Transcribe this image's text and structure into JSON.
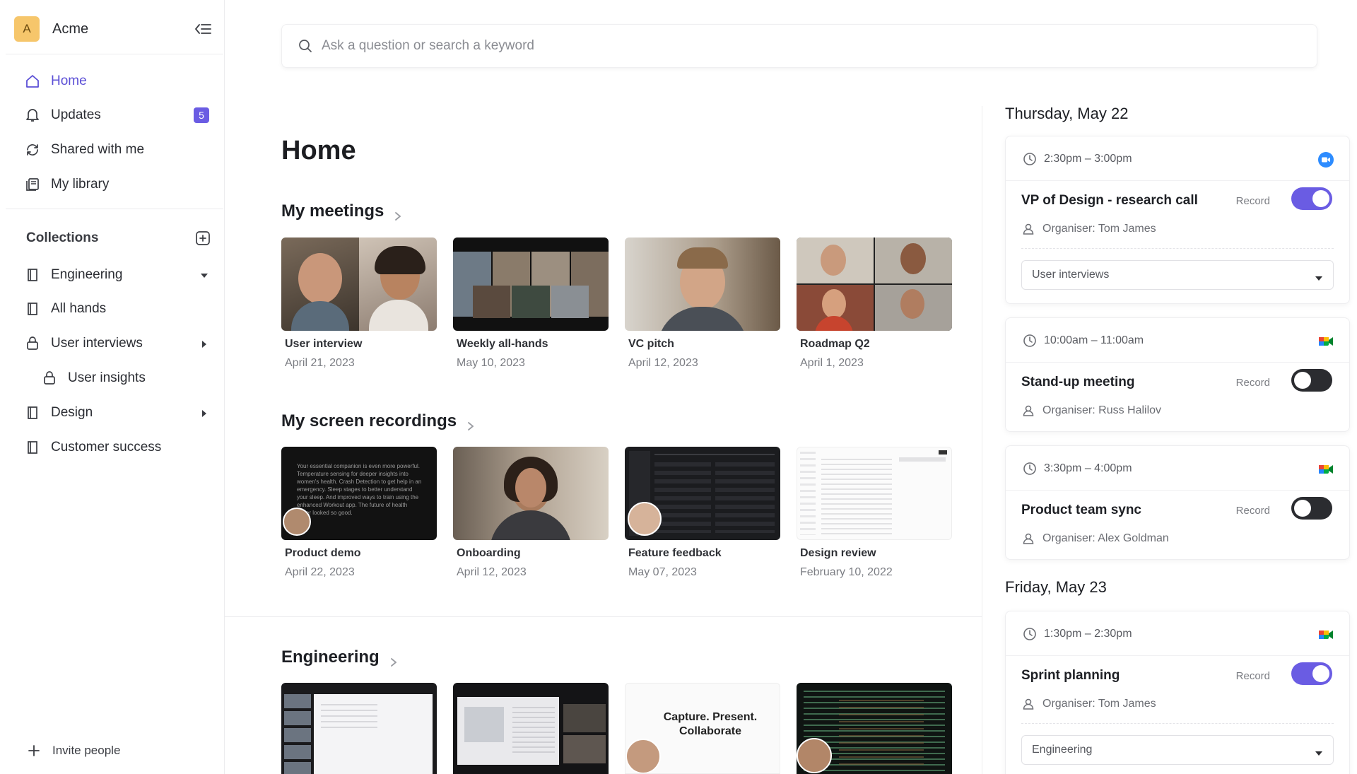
{
  "workspace": {
    "initial": "A",
    "name": "Acme"
  },
  "nav": {
    "home": "Home",
    "updates": "Updates",
    "updates_count": "5",
    "shared": "Shared with me",
    "library": "My library"
  },
  "collections": {
    "header": "Collections",
    "items": [
      {
        "label": "Engineering"
      },
      {
        "label": "All hands"
      },
      {
        "label": "User interviews"
      },
      {
        "label": "User insights"
      },
      {
        "label": "Design"
      },
      {
        "label": "Customer success"
      }
    ]
  },
  "invite": "Invite people",
  "search": {
    "placeholder": "Ask a question or search a keyword"
  },
  "page_title": "Home",
  "sections": {
    "meetings": {
      "title": "My meetings",
      "cards": [
        {
          "title": "User interview",
          "date": "April 21, 2023"
        },
        {
          "title": "Weekly all-hands",
          "date": "May 10, 2023"
        },
        {
          "title": "VC pitch",
          "date": "April 12, 2023"
        },
        {
          "title": "Roadmap Q2",
          "date": "April 1, 2023"
        }
      ]
    },
    "recordings": {
      "title": "My screen recordings",
      "cards": [
        {
          "title": "Product demo",
          "date": "April 22, 2023"
        },
        {
          "title": "Onboarding",
          "date": "April 12, 2023"
        },
        {
          "title": "Feature feedback",
          "date": "May 07, 2023"
        },
        {
          "title": "Design review",
          "date": "February 10, 2022"
        }
      ]
    },
    "engineering": {
      "title": "Engineering",
      "capture_text": "Capture. Present. Collaborate"
    }
  },
  "product_demo_text": "Your essential companion is even more powerful. Temperature sensing for deeper insights into women's health. Crash Detection to get help in an emergency. Sleep stages to better understand your sleep. And improved ways to train using the enhanced Workout app. The future of health never looked so good.",
  "schedule": {
    "days": [
      {
        "label": "Thursday, May 22",
        "events": [
          {
            "time": "2:30pm – 3:00pm",
            "app": "zoom-icon",
            "title": "VP of Design - research call",
            "record_label": "Record",
            "record_on": true,
            "organiser": "Organiser: Tom James",
            "collection": "User interviews"
          },
          {
            "time": "10:00am – 11:00am",
            "app": "google-meet-icon",
            "title": "Stand-up meeting",
            "record_label": "Record",
            "record_on": false,
            "organiser": "Organiser: Russ Halilov"
          },
          {
            "time": "3:30pm – 4:00pm",
            "app": "google-meet-icon",
            "title": "Product team sync",
            "record_label": "Record",
            "record_on": false,
            "organiser": "Organiser: Alex Goldman"
          }
        ]
      },
      {
        "label": "Friday, May 23",
        "events": [
          {
            "time": "1:30pm – 2:30pm",
            "app": "google-meet-icon",
            "title": "Sprint planning",
            "record_label": "Record",
            "record_on": true,
            "organiser": "Organiser: Tom James",
            "collection": "Engineering"
          }
        ]
      }
    ]
  },
  "colors": {
    "accent": "#6a5ce3",
    "toggle_off": "#2b2c30",
    "workspace_avatar": "#f6c66b"
  }
}
